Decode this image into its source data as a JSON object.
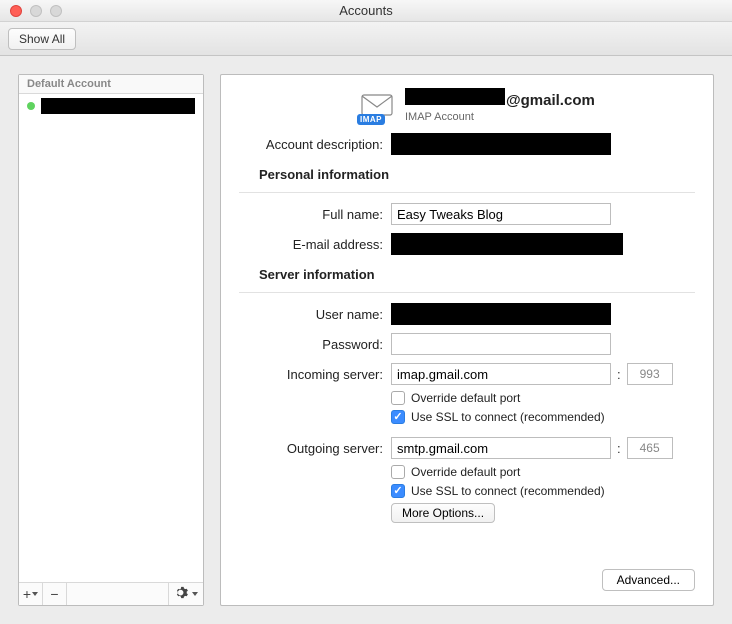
{
  "window": {
    "title": "Accounts",
    "toolbar": {
      "show_all": "Show All"
    }
  },
  "sidebar": {
    "header": "Default Account",
    "accounts": [
      {
        "name": "",
        "status": "online"
      }
    ],
    "footer": {
      "add": "+",
      "remove": "−"
    }
  },
  "main": {
    "header": {
      "title_prefix_redacted": true,
      "title_suffix": "@gmail.com",
      "subtitle": "IMAP Account",
      "badge": "IMAP"
    },
    "fields": {
      "description_label": "Account description:",
      "description_value": "",
      "personal_section": "Personal information",
      "fullname_label": "Full name:",
      "fullname_value": "Easy Tweaks Blog",
      "email_label": "E-mail address:",
      "email_value": "",
      "server_section": "Server information",
      "username_label": "User name:",
      "username_value": "",
      "password_label": "Password:",
      "password_value": "",
      "incoming_label": "Incoming server:",
      "incoming_value": "imap.gmail.com",
      "incoming_port": "993",
      "outgoing_label": "Outgoing server:",
      "outgoing_value": "smtp.gmail.com",
      "outgoing_port": "465",
      "override_port_label": "Override default port",
      "ssl_label": "Use SSL to connect (recommended)",
      "more_options": "More Options...",
      "advanced": "Advanced..."
    },
    "state": {
      "incoming_override": false,
      "incoming_ssl": true,
      "outgoing_override": false,
      "outgoing_ssl": true
    }
  }
}
